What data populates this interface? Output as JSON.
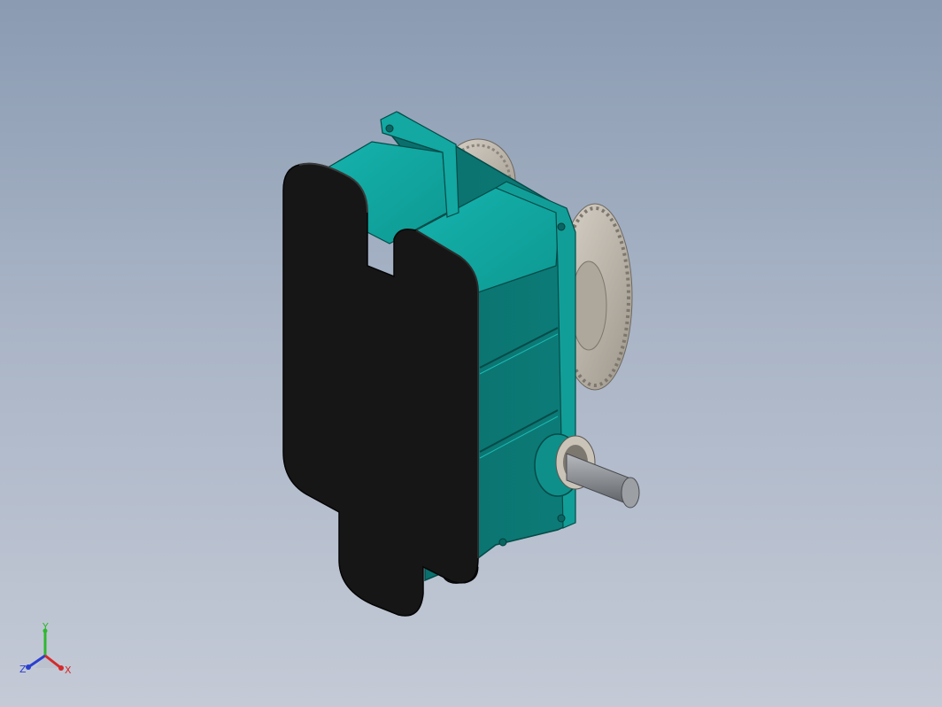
{
  "view": {
    "background_top": "#8a9bb2",
    "background_bottom": "#c4cad6"
  },
  "model": {
    "housing_color": "#0f8f8a",
    "cover_plate_color": "#161616",
    "gear_color": "#b9b3aa",
    "shaft_color": "#8e9196"
  },
  "triad": {
    "y_label": "Y",
    "z_label": "Z",
    "x_label": "X",
    "y_color": "#2fb82f",
    "z_color": "#2b3fcf",
    "x_color": "#d42a2a"
  }
}
